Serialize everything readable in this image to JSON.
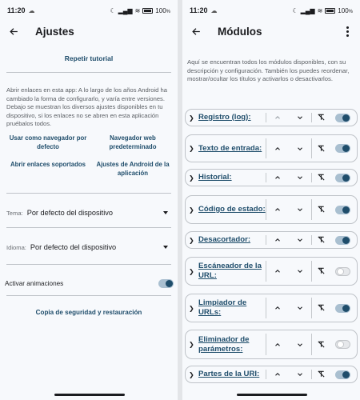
{
  "status": {
    "time": "11:20",
    "cloud_icon": "cloud-icon",
    "battery_pct": "100",
    "battery_unit": "%"
  },
  "left": {
    "title": "Ajustes",
    "tutorial_label": "Repetir tutorial",
    "description": "Abrir enlaces en esta app: A lo largo de los años Android ha cambiado la forma de configurarlo, y varía entre versiones. Debajo se muestran los diversos ajustes disponibles en tu dispositivo, si los enlaces no se abren en esta aplicación pruébalos todos.",
    "buttons": [
      "Usar como navegador por defecto",
      "Navegador web predeterminado",
      "Abrir enlaces soportados",
      "Ajustes de Android de la aplicación"
    ],
    "theme_label": "Tema:",
    "theme_value": "Por defecto del dispositivo",
    "language_label": "Idioma:",
    "language_value": "Por defecto del dispositivo",
    "animations_label": "Activar animaciones",
    "animations_on": true,
    "backup_label": "Copia de seguridad y restauración"
  },
  "right": {
    "title": "Módulos",
    "description": "Aquí se encuentran todos los módulos disponibles, con su descripción y configuración. También los puedes reordenar, mostrar/ocultar los títulos y activarlos o desactivarlos.",
    "modules": [
      {
        "name": "Registro (log):",
        "enabled": true,
        "up_disabled": true
      },
      {
        "name": "Texto de entrada:",
        "enabled": true,
        "up_disabled": false
      },
      {
        "name": "Historial:",
        "enabled": true,
        "up_disabled": false
      },
      {
        "name": "Código de estado:",
        "enabled": true,
        "up_disabled": false
      },
      {
        "name": "Desacortador:",
        "enabled": true,
        "up_disabled": false
      },
      {
        "name": "Escáneador de la URL:",
        "enabled": false,
        "up_disabled": false
      },
      {
        "name": "Limpiador de URLs:",
        "enabled": true,
        "up_disabled": false
      },
      {
        "name": "Eliminador de parámetros:",
        "enabled": false,
        "up_disabled": false
      },
      {
        "name": "Partes de la URI:",
        "enabled": true,
        "up_disabled": false
      }
    ]
  },
  "icons": {
    "back": "arrow-back-icon",
    "more": "more-vert-icon",
    "dropdown": "arrow-drop-down-icon",
    "expand": "chevron-right-icon",
    "up": "chevron-up-icon",
    "down": "chevron-down-icon",
    "title_toggle": "title-off-icon"
  },
  "colors": {
    "accent": "#1f4d6b",
    "switch_track_on": "#a9bfd0",
    "background": "#f7f9fc"
  }
}
